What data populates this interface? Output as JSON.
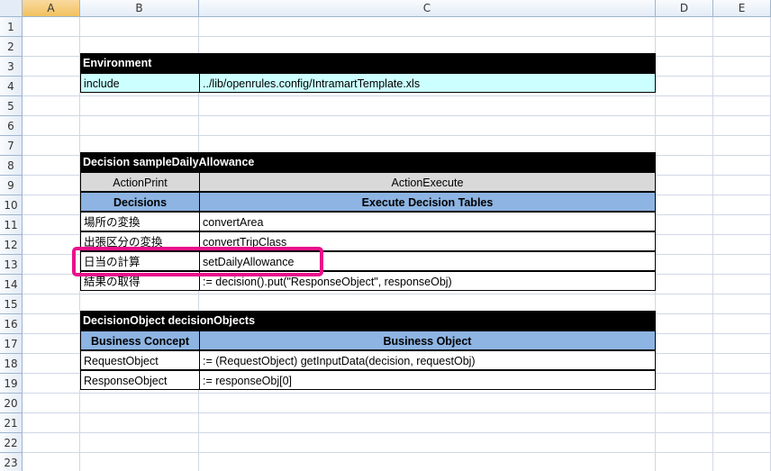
{
  "columns": [
    "A",
    "B",
    "C",
    "D",
    "E"
  ],
  "rows": [
    "1",
    "2",
    "3",
    "4",
    "5",
    "6",
    "7",
    "8",
    "9",
    "10",
    "11",
    "12",
    "13",
    "14",
    "15",
    "16",
    "17",
    "18",
    "19",
    "20",
    "21",
    "22",
    "23"
  ],
  "environment": {
    "title": "Environment",
    "label": "include",
    "value": "../lib/openrules.config/IntramartTemplate.xls"
  },
  "decision": {
    "title": "Decision sampleDailyAllowance",
    "action_print": "ActionPrint",
    "action_execute": "ActionExecute",
    "col1_header": "Decisions",
    "col2_header": "Execute Decision Tables",
    "rows": [
      {
        "name": "場所の変換",
        "value": "convertArea"
      },
      {
        "name": "出張区分の変換",
        "value": "convertTripClass"
      },
      {
        "name": "日当の計算",
        "value": "setDailyAllowance"
      },
      {
        "name": "結果の取得",
        "value": ":= decision().put(\"ResponseObject\", responseObj)"
      }
    ]
  },
  "decision_objects": {
    "title": "DecisionObject decisionObjects",
    "col1_header": "Business Concept",
    "col2_header": "Business Object",
    "rows": [
      {
        "name": "RequestObject",
        "value": ":=  (RequestObject) getInputData(decision, requestObj)"
      },
      {
        "name": "ResponseObject",
        "value": ":=  responseObj[0]"
      }
    ]
  },
  "colors": {
    "header_black": "#000000",
    "cyan": "#ccffff",
    "blue_header": "#8db4e2",
    "grey_header": "#d9d9d9",
    "highlight": "#e8108a"
  }
}
